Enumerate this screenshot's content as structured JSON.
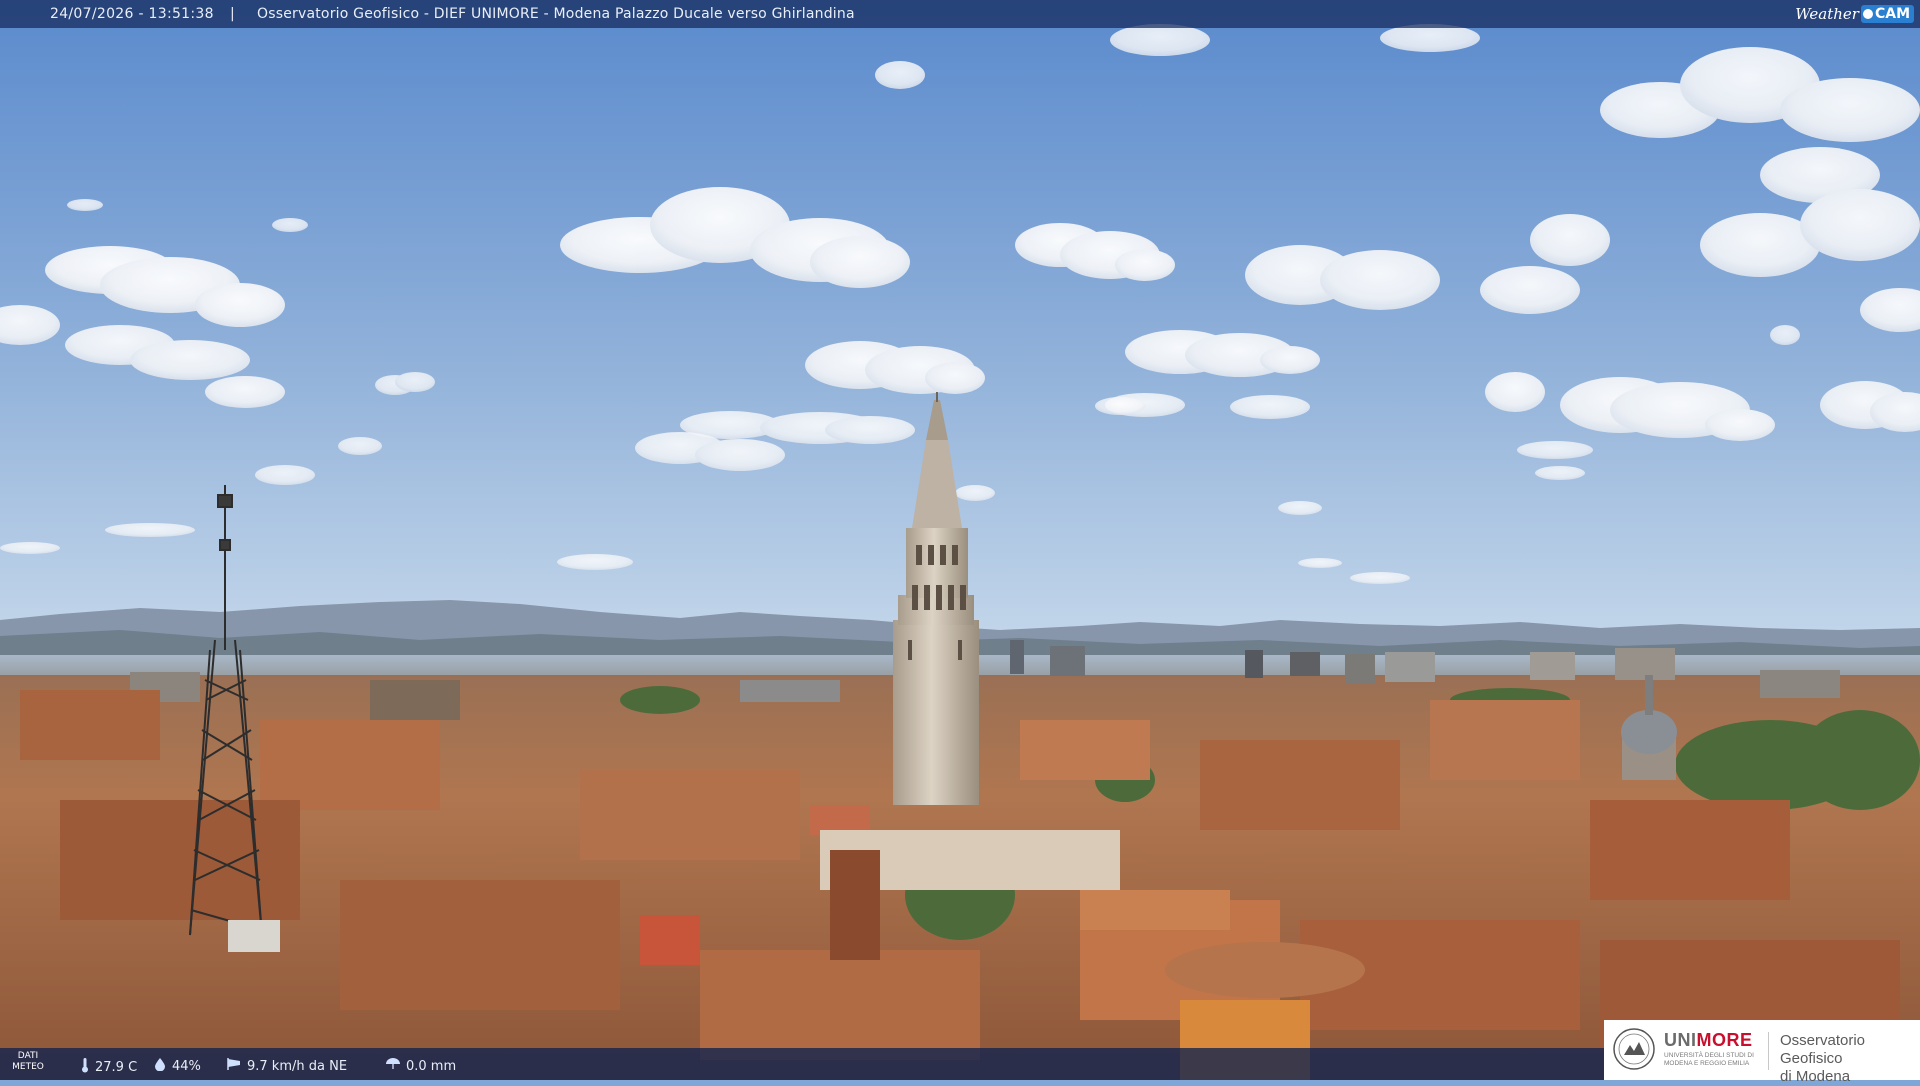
{
  "overlay_top": {
    "timestamp": "24/07/2026 - 13:51:38",
    "separator": "|",
    "location": "Osservatorio Geofisico - DIEF UNIMORE - Modena Palazzo Ducale verso Ghirlandina",
    "brand_weather": "Weather",
    "brand_cam": "CAM"
  },
  "overlay_bottom": {
    "label_line1": "DATI",
    "label_line2": "METEO",
    "temperature": "27.9 C",
    "humidity": "44%",
    "wind": "9.7 km/h da NE",
    "rain": "0.0 mm"
  },
  "logo": {
    "uni_gray": "UNI",
    "uni_red": "MORE",
    "uni_sub": "UNIVERSITÀ DEGLI STUDI DI MODENA E REGGIO EMILIA",
    "obs_line1": "Osservatorio Geofisico",
    "obs_line2": "di Modena"
  },
  "colors": {
    "sky_top": "#5f8ed0",
    "sky_bottom": "#b9d0e6",
    "mountains": "#7e8ea6",
    "roof": "#b8744a",
    "tower": "#cfc3b0",
    "accent_red": "#c8102e",
    "bar_blue": "#14285a"
  },
  "icons": {
    "temperature": "thermometer-icon",
    "humidity": "droplet-icon",
    "wind": "windsock-icon",
    "rain": "umbrella-icon"
  }
}
